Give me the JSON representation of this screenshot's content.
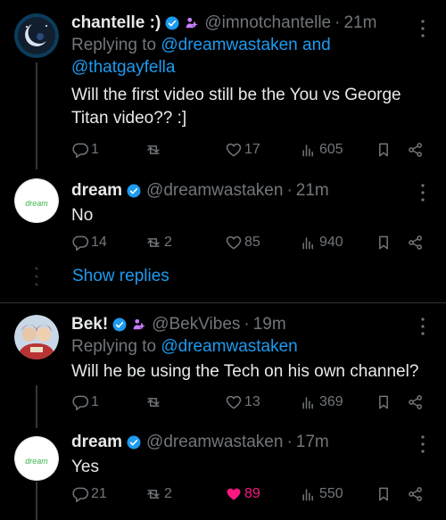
{
  "tweets": [
    {
      "name": "chantelle :)",
      "handle": "@imnotchantelle",
      "time": "21m",
      "replying_prefix": "Replying to ",
      "replying_mention1": "@dreamwastaken",
      "replying_and": " and",
      "replying_mention2": "@thatgayfella",
      "text_line1": "Will the first video still be the You vs George",
      "text_line2": "Titan video?? :]",
      "replies": "1",
      "retweets": "",
      "likes": "17",
      "views": "605",
      "liked": false
    },
    {
      "name": "dream",
      "handle": "@dreamwastaken",
      "time": "21m",
      "text_line1": "No",
      "replies": "14",
      "retweets": "2",
      "likes": "85",
      "views": "940",
      "liked": false
    },
    {
      "name": "Bek!",
      "handle": "@BekVibes",
      "time": "19m",
      "replying_prefix": "Replying to ",
      "replying_mention1": "@dreamwastaken",
      "text_line1": "Will he be using the Tech on his own channel?",
      "replies": "1",
      "retweets": "",
      "likes": "13",
      "views": "369",
      "liked": false
    },
    {
      "name": "dream",
      "handle": "@dreamwastaken",
      "time": "17m",
      "text_line1": "Yes",
      "replies": "21",
      "retweets": "2",
      "likes": "89",
      "views": "550",
      "liked": true
    }
  ],
  "show_replies": "Show replies",
  "dream_avatar_text": "dream",
  "dot": "·",
  "colors": {
    "accent": "#1d9bf0",
    "like": "#f91880",
    "muted": "#71767b"
  }
}
